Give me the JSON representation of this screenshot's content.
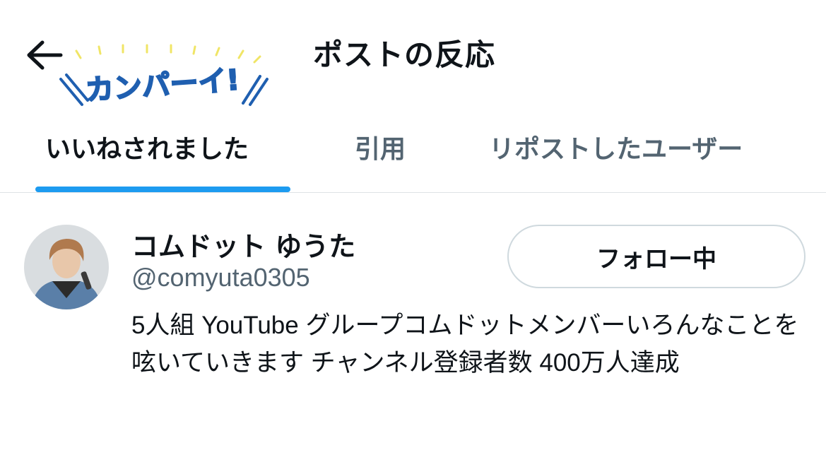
{
  "header": {
    "title": "ポストの反応",
    "back_icon": "arrow-left-icon",
    "sticker": {
      "text": "カンパーイ!",
      "color": "#1f5fb0",
      "ray_color": "#f0e566"
    }
  },
  "tabs": [
    {
      "label": "いいねされました",
      "active": true
    },
    {
      "label": "引用",
      "active": false
    },
    {
      "label": "リポストしたユーザー",
      "active": false
    }
  ],
  "colors": {
    "accent": "#1d9bf0",
    "text_primary": "#0f1419",
    "text_secondary": "#536471",
    "border": "#cfd9de"
  },
  "user": {
    "display_name": "コムドット ゆうた",
    "handle": "@comyuta0305",
    "follow_button_label": "フォロー中",
    "bio": "5人組 YouTube グループコムドットメンバーいろんなことを呟いていきます チャンネル登録者数 400万人達成"
  }
}
